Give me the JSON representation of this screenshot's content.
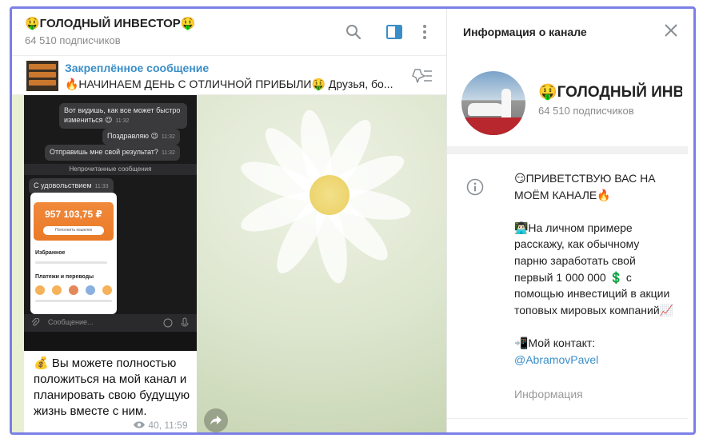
{
  "channel": {
    "title": "🤑ГОЛОДНЫЙ ИНВЕСТОР🤑",
    "subscribers": "64 510 подписчиков"
  },
  "header_icons": [
    "search-icon",
    "sidebar-toggle-icon",
    "more-vertical-icon"
  ],
  "pinned": {
    "label": "Закреплённое сообщение",
    "text": "🔥НАЧИНАЕМ ДЕНЬ С ОТЛИЧНОЙ ПРИБЫЛИ🤑  Друзья, бо..."
  },
  "screenshot": {
    "bubble1": "Вот видишь, как все может быстро измениться 😉",
    "bubble1_time": "11:32",
    "bubble2": "Поздравляю 😉",
    "bubble2_time": "11:32",
    "bubble3": "Отправишь мне свой результат?",
    "bubble3_time": "11:32",
    "unread_label": "Непрочитанные сообщения",
    "incoming": "С удовольствием",
    "incoming_time": "11:33",
    "amount": "957 103,75 ₽",
    "pay_button": "Пополнить кошелек",
    "favorites": "Избранное",
    "payments": "Платежи и переводы",
    "input_placeholder": "Сообщение..."
  },
  "message": {
    "caption": "💰 Вы можете полностью положиться на мой канал и планировать свою будущую жизнь вместе с ним.",
    "views": "40",
    "time": "11:59"
  },
  "info": {
    "title": "Информация о канале",
    "name": "🤑ГОЛОДНЫЙ ИНВЕСТОР🤑",
    "subscribers": "64 510 подписчиков",
    "about_p1": "😏ПРИВЕТСТВУЮ ВАС НА МОЁМ КАНАЛЕ🔥",
    "about_p2": "👨🏻‍💻На личном примере расскажу, как обычному парню заработать свой первый 1 000 000 💲 с помощью инвестиций в акции топовых мировых компаний📈",
    "contact_label": "📲Мой контакт:",
    "contact_link": "@AbramovPavel",
    "footer": "Информация"
  },
  "colors": {
    "frame": "#7b7fe6",
    "accent": "#3a8ec8",
    "orange_card": "#ea7a27"
  }
}
